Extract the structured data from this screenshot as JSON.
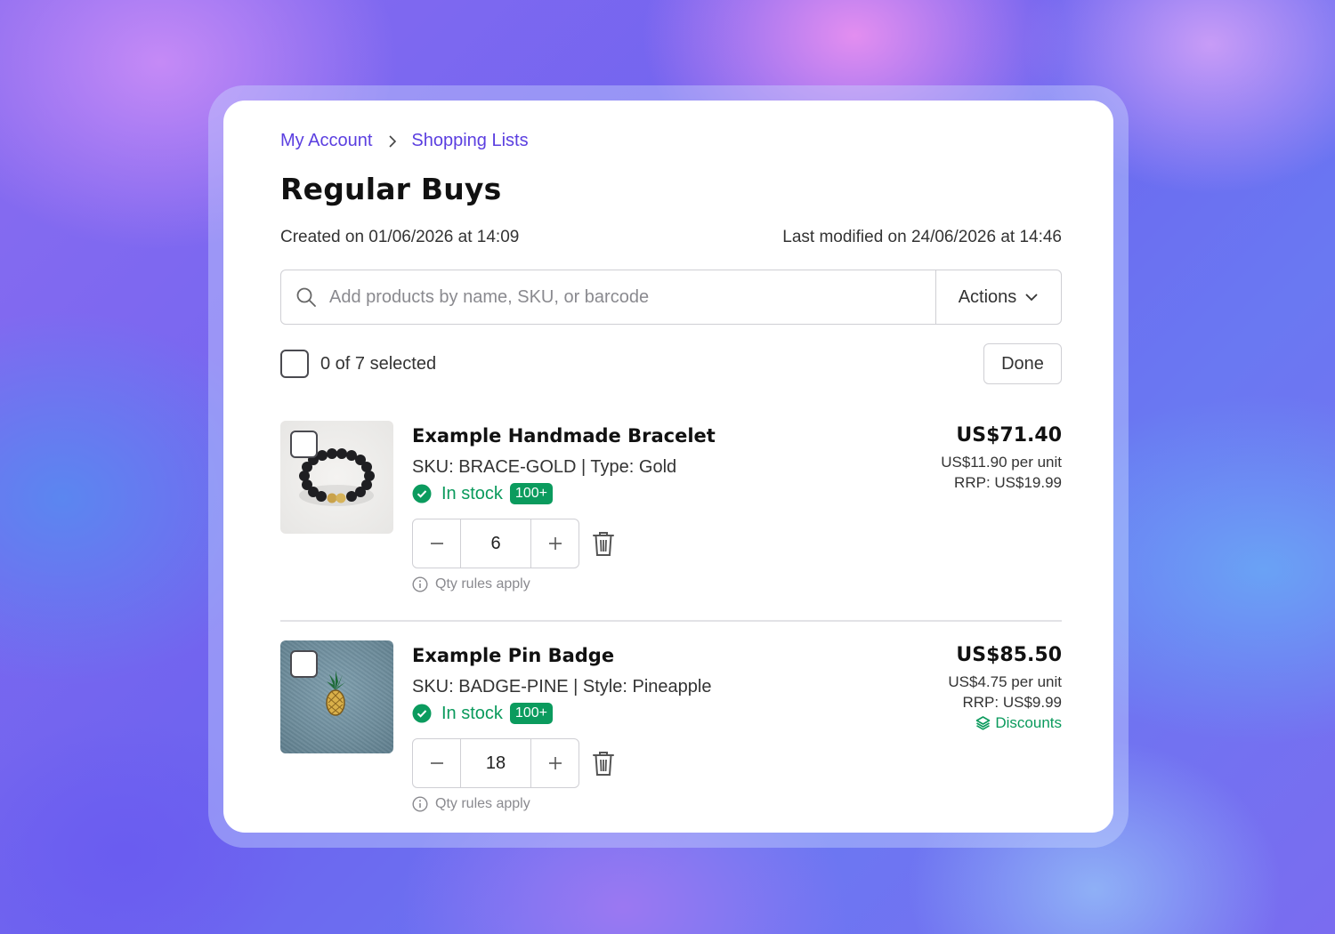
{
  "breadcrumb": {
    "root": "My Account",
    "current": "Shopping Lists"
  },
  "list": {
    "title": "Regular Buys",
    "created": "Created on 01/06/2026 at 14:09",
    "modified": "Last modified on 24/06/2026 at 14:46"
  },
  "search": {
    "placeholder": "Add products by name, SKU, or barcode",
    "value": ""
  },
  "actions": {
    "label": "Actions"
  },
  "selection": {
    "text": "0 of 7 selected",
    "done_label": "Done"
  },
  "items": [
    {
      "name": "Example Handmade Bracelet",
      "sku": "SKU: BRACE-GOLD | Type: Gold",
      "stock": "In stock",
      "badge": "100+",
      "qty": "6",
      "rules": "Qty rules apply",
      "price": "US$71.40",
      "unit": "US$11.90 per unit",
      "rrp": "RRP: US$19.99"
    },
    {
      "name": "Example Pin Badge",
      "sku": "SKU: BADGE-PINE | Style: Pineapple",
      "stock": "In stock",
      "badge": "100+",
      "qty": "18",
      "rules": "Qty rules apply",
      "price": "US$85.50",
      "unit": "US$4.75 per unit",
      "rrp": "RRP: US$9.99",
      "discounts": "Discounts"
    }
  ],
  "colors": {
    "link": "#5b3fe0",
    "success": "#0a9a5c",
    "text": "#111111"
  },
  "icons": [
    "chevron-right-icon",
    "search-icon",
    "chevron-down-icon",
    "check-circle-icon",
    "minus-icon",
    "plus-icon",
    "trash-icon",
    "info-icon",
    "layers-icon"
  ]
}
